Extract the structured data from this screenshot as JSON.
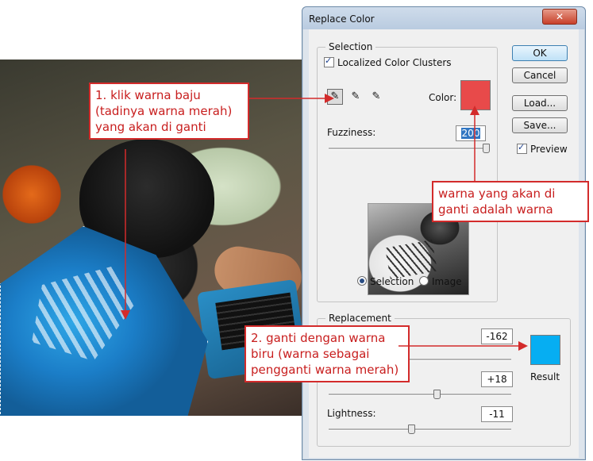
{
  "dialog": {
    "title": "Replace Color",
    "close_glyph": "✕",
    "selection": {
      "group_label": "Selection",
      "localized_clusters_label": "Localized Color Clusters",
      "localized_clusters_checked": true,
      "color_label": "Color:",
      "sample_color": "#e84a4a",
      "fuzziness_label": "Fuzziness:",
      "fuzziness_value": "200",
      "fuzziness_fraction": 0.99,
      "view_selection_label": "Selection",
      "view_image_label": "Image",
      "view_selected": "selection"
    },
    "buttons": {
      "ok": "OK",
      "cancel": "Cancel",
      "load": "Load...",
      "save": "Save...",
      "preview_label": "Preview",
      "preview_checked": true
    },
    "replacement": {
      "group_label": "Replacement",
      "hue_value": "-162",
      "hue_fraction": 0.05,
      "saturation_value": "+18",
      "saturation_fraction": 0.59,
      "lightness_label": "Lightness:",
      "lightness_value": "-11",
      "lightness_fraction": 0.45,
      "result_label": "Result",
      "result_color": "#06aef2"
    }
  },
  "annotations": {
    "note1": [
      "1. klik warna baju",
      "(tadinya warna merah)",
      "yang akan di ganti"
    ],
    "note2": [
      "warna yang akan di",
      "ganti adalah warna"
    ],
    "note3": [
      "2. ganti dengan warna",
      "biru (warna sebagai",
      "pengganti warna merah)"
    ],
    "accent_color": "#d32b2b"
  }
}
